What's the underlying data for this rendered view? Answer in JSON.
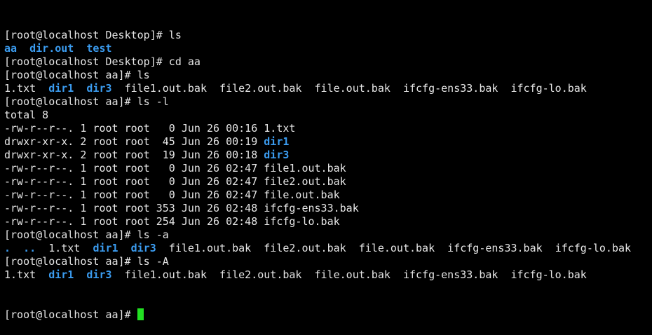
{
  "colors": {
    "background": "#000000",
    "text": "#e6e6e6",
    "directory": "#3b9cf0",
    "cursor": "#22e022"
  },
  "terminal": {
    "lines": [
      [
        {
          "t": "[root@localhost Desktop]# ls",
          "k": "prompt"
        }
      ],
      [
        {
          "t": "aa",
          "k": "dir"
        },
        {
          "t": "  "
        },
        {
          "t": "dir.out",
          "k": "dir"
        },
        {
          "t": "  "
        },
        {
          "t": "test",
          "k": "dir"
        }
      ],
      [
        {
          "t": "[root@localhost Desktop]# cd aa",
          "k": "prompt"
        }
      ],
      [
        {
          "t": "[root@localhost aa]# ls",
          "k": "prompt"
        }
      ],
      [
        {
          "t": "1.txt  "
        },
        {
          "t": "dir1",
          "k": "dir"
        },
        {
          "t": "  "
        },
        {
          "t": "dir3",
          "k": "dir"
        },
        {
          "t": "  file1.out.bak  file2.out.bak  file.out.bak  ifcfg-ens33.bak  ifcfg-lo.bak"
        }
      ],
      [
        {
          "t": "[root@localhost aa]# ls -l",
          "k": "prompt"
        }
      ],
      [
        {
          "t": "total 8"
        }
      ],
      [
        {
          "t": "-rw-r--r--. 1 root root   0 Jun 26 00:16 1.txt"
        }
      ],
      [
        {
          "t": "drwxr-xr-x. 2 root root  45 Jun 26 00:19 "
        },
        {
          "t": "dir1",
          "k": "dir"
        }
      ],
      [
        {
          "t": "drwxr-xr-x. 2 root root  19 Jun 26 00:18 "
        },
        {
          "t": "dir3",
          "k": "dir"
        }
      ],
      [
        {
          "t": "-rw-r--r--. 1 root root   0 Jun 26 02:47 file1.out.bak"
        }
      ],
      [
        {
          "t": "-rw-r--r--. 1 root root   0 Jun 26 02:47 file2.out.bak"
        }
      ],
      [
        {
          "t": "-rw-r--r--. 1 root root   0 Jun 26 02:47 file.out.bak"
        }
      ],
      [
        {
          "t": "-rw-r--r--. 1 root root 353 Jun 26 02:48 ifcfg-ens33.bak"
        }
      ],
      [
        {
          "t": "-rw-r--r--. 1 root root 254 Jun 26 02:48 ifcfg-lo.bak"
        }
      ],
      [
        {
          "t": "[root@localhost aa]# ls -a",
          "k": "prompt"
        }
      ],
      [
        {
          "t": ".",
          "k": "dir"
        },
        {
          "t": "  "
        },
        {
          "t": "..",
          "k": "dir"
        },
        {
          "t": "  1.txt  "
        },
        {
          "t": "dir1",
          "k": "dir"
        },
        {
          "t": "  "
        },
        {
          "t": "dir3",
          "k": "dir"
        },
        {
          "t": "  file1.out.bak  file2.out.bak  file.out.bak  ifcfg-ens33.bak  ifcfg-lo.bak"
        }
      ],
      [
        {
          "t": "[root@localhost aa]# ls -A",
          "k": "prompt"
        }
      ],
      [
        {
          "t": "1.txt  "
        },
        {
          "t": "dir1",
          "k": "dir"
        },
        {
          "t": "  "
        },
        {
          "t": "dir3",
          "k": "dir"
        },
        {
          "t": "  file1.out.bak  file2.out.bak  file.out.bak  ifcfg-ens33.bak  ifcfg-lo.bak"
        }
      ]
    ],
    "current_prompt": "[root@localhost aa]# "
  }
}
